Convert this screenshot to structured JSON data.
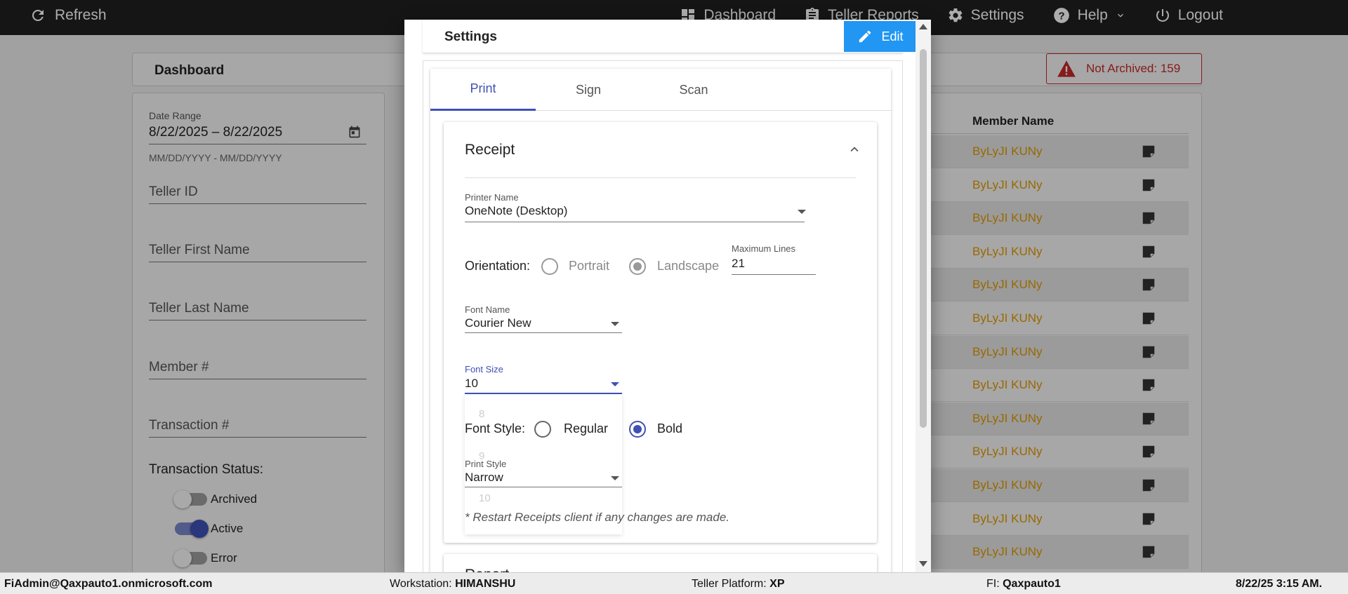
{
  "topbar": {
    "refresh_label": "Refresh",
    "nav": [
      {
        "label": "Dashboard",
        "icon": "dashboard-icon"
      },
      {
        "label": "Teller Reports",
        "icon": "clipboard-icon"
      },
      {
        "label": "Settings",
        "icon": "gear-icon"
      },
      {
        "label": "Help",
        "icon": "help-icon"
      },
      {
        "label": "Logout",
        "icon": "power-icon"
      }
    ]
  },
  "dashboard": {
    "title": "Dashboard",
    "not_archived": "Not Archived: 159",
    "filters": {
      "date_range_label": "Date Range",
      "date_range_value": "8/22/2025 – 8/22/2025",
      "date_range_hint": "MM/DD/YYYY - MM/DD/YYYY",
      "teller_id": "Teller ID",
      "teller_first_name": "Teller First Name",
      "teller_last_name": "Teller Last Name",
      "member_number": "Member #",
      "transaction_number": "Transaction #",
      "transaction_status_title": "Transaction Status:",
      "statuses": [
        {
          "label": "Archived",
          "on": false
        },
        {
          "label": "Active",
          "on": true
        },
        {
          "label": "Error",
          "on": false
        }
      ]
    },
    "table": {
      "member_name_header": "Member Name",
      "rows": [
        "ByLyJI KUNy",
        "ByLyJI KUNy",
        "ByLyJI KUNy",
        "ByLyJI KUNy",
        "ByLyJI KUNy",
        "ByLyJI KUNy",
        "ByLyJI KUNy",
        "ByLyJI KUNy",
        "ByLyJI KUNy",
        "ByLyJI KUNy",
        "ByLyJI KUNy",
        "ByLyJI KUNy",
        "ByLyJI KUNy"
      ]
    }
  },
  "modal": {
    "title": "Settings",
    "edit_label": "Edit",
    "tabs": [
      "Print",
      "Sign",
      "Scan"
    ],
    "active_tab": "Print",
    "receipt": {
      "title": "Receipt",
      "printer_name_label": "Printer Name",
      "printer_name_value": "OneNote (Desktop)",
      "orientation_label": "Orientation:",
      "portrait_label": "Portrait",
      "landscape_label": "Landscape",
      "max_lines_label": "Maximum Lines",
      "max_lines_value": "21",
      "font_name_label": "Font Name",
      "font_name_value": "Courier New",
      "font_size_label": "Font Size",
      "font_size_value": "10",
      "font_style_label": "Font Style:",
      "regular_label": "Regular",
      "bold_label": "Bold",
      "print_style_label": "Print Style",
      "print_style_value": "Narrow",
      "ghost_options": [
        "8",
        "9",
        "10"
      ],
      "restart_note": "* Restart Receipts client if any changes are made."
    },
    "report_title": "Report"
  },
  "statusbar": {
    "user": "FiAdmin@Qaxpauto1.onmicrosoft.com",
    "workstation_label": "Workstation: ",
    "workstation_value": "HIMANSHU",
    "platform_label": "Teller Platform: ",
    "platform_value": "XP",
    "fi_label": "FI: ",
    "fi_value": "Qaxpauto1",
    "datetime": "8/22/25 3:15 AM."
  },
  "colors": {
    "accent": "#3f51b5",
    "edit_button": "#2196f3",
    "member_name": "#e19a00",
    "alert": "#c62828"
  }
}
